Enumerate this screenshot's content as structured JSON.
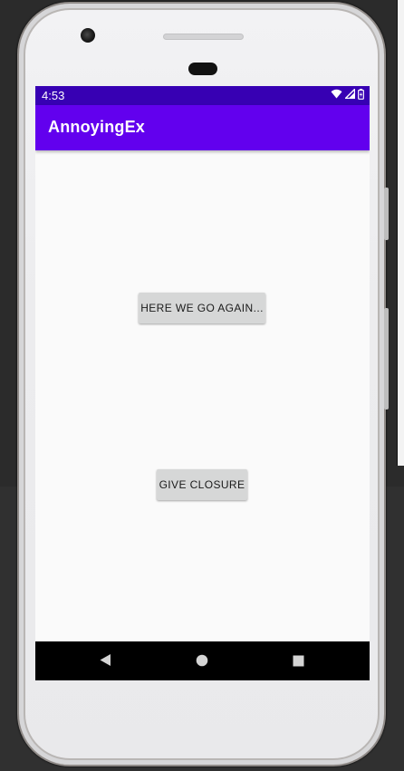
{
  "status_bar": {
    "time": "4:53",
    "icons": [
      "wifi-icon",
      "signal-icon",
      "battery-icon"
    ]
  },
  "app_bar": {
    "title": "AnnoyingEx"
  },
  "main": {
    "buttons": [
      {
        "label": "HERE WE GO AGAIN..."
      },
      {
        "label": "GIVE CLOSURE"
      }
    ]
  },
  "nav_bar": {
    "items": [
      "back-icon",
      "home-icon",
      "recents-icon"
    ]
  },
  "colors": {
    "status_bar": "#3700b3",
    "app_bar": "#6200ee",
    "screen_bg": "#fafafa",
    "button_bg": "#d6d7d7",
    "nav_bar": "#000000"
  }
}
